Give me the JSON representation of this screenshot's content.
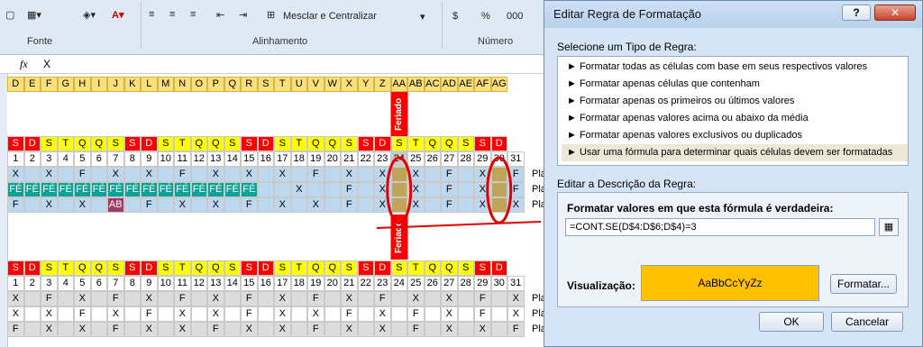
{
  "ribbon": {
    "groups": [
      "Fonte",
      "Alinhamento",
      "Número"
    ],
    "merge_label": "Mesclar e Centralizar",
    "currency_symbol": "$",
    "percent_symbol": "%",
    "thousands_symbol": "000"
  },
  "formula_bar": {
    "fx": "fx",
    "value": "X"
  },
  "sheet": {
    "columns": [
      "D",
      "E",
      "F",
      "G",
      "H",
      "I",
      "J",
      "K",
      "L",
      "M",
      "N",
      "O",
      "P",
      "Q",
      "R",
      "S",
      "T",
      "U",
      "V",
      "W",
      "X",
      "Y",
      "Z",
      "AA",
      "AB",
      "AC",
      "AD",
      "AE",
      "AF",
      "AG"
    ],
    "holiday_label": "Feriado",
    "weekdays": [
      "S",
      "D",
      "S",
      "T",
      "Q",
      "Q",
      "S",
      "S",
      "D",
      "S",
      "T",
      "Q",
      "Q",
      "S",
      "S",
      "D",
      "S",
      "T",
      "Q",
      "Q",
      "S",
      "S",
      "D",
      "S",
      "T",
      "Q",
      "Q",
      "S",
      "S",
      "D"
    ],
    "days": [
      "1",
      "2",
      "3",
      "4",
      "5",
      "6",
      "7",
      "8",
      "9",
      "10",
      "11",
      "12",
      "13",
      "14",
      "15",
      "16",
      "17",
      "18",
      "19",
      "20",
      "21",
      "22",
      "23",
      "24",
      "25",
      "26",
      "27",
      "28",
      "29",
      "30",
      "31"
    ],
    "row1": [
      "X",
      "",
      "X",
      "",
      "F",
      "",
      "X",
      "",
      "X",
      "",
      "F",
      "",
      "X",
      "",
      "X",
      "",
      "X",
      "",
      "F",
      "",
      "X",
      "",
      "X",
      "",
      "X",
      "",
      "F",
      "",
      "X",
      "",
      "F"
    ],
    "row2": [
      "FÉ",
      "FÉ",
      "FÉ",
      "FÉ",
      "FÉ",
      "FÉ",
      "FÉ",
      "FÉ",
      "FÉ",
      "FÉ",
      "FÉ",
      "FÉ",
      "FÉ",
      "FÉ",
      "FÉ",
      "",
      "",
      "X",
      "",
      "",
      "F",
      "",
      "X",
      "",
      "X",
      "",
      "F",
      "",
      "X",
      "",
      "F"
    ],
    "row3": [
      "F",
      "",
      "X",
      "",
      "X",
      "",
      "AB",
      "",
      "F",
      "",
      "X",
      "",
      "X",
      "",
      "F",
      "",
      "X",
      "",
      "X",
      "",
      "F",
      "",
      "X",
      "",
      "X",
      "",
      "F",
      "",
      "X",
      "",
      "X"
    ],
    "weekdays_b": [
      "S",
      "D",
      "S",
      "T",
      "Q",
      "Q",
      "S",
      "S",
      "D",
      "S",
      "T",
      "Q",
      "Q",
      "S",
      "S",
      "D",
      "S",
      "T",
      "Q",
      "Q",
      "S",
      "S",
      "D",
      "S",
      "T",
      "Q",
      "Q",
      "S",
      "S",
      "D"
    ],
    "days_b": [
      "1",
      "2",
      "3",
      "4",
      "5",
      "6",
      "7",
      "8",
      "9",
      "10",
      "11",
      "12",
      "13",
      "14",
      "15",
      "16",
      "17",
      "18",
      "19",
      "20",
      "21",
      "22",
      "23",
      "24",
      "25",
      "26",
      "27",
      "28",
      "29",
      "30",
      "31"
    ],
    "row4": [
      "X",
      "",
      "F",
      "",
      "X",
      "",
      "F",
      "",
      "X",
      "",
      "F",
      "",
      "X",
      "",
      "F",
      "",
      "X",
      "",
      "F",
      "",
      "X",
      "",
      "F",
      "",
      "X",
      "",
      "X",
      "",
      "F",
      "",
      "X"
    ],
    "row5": [
      "X",
      "",
      "X",
      "",
      "F",
      "",
      "X",
      "",
      "F",
      "",
      "X",
      "",
      "X",
      "",
      "F",
      "",
      "X",
      "",
      "X",
      "",
      "F",
      "",
      "X",
      "",
      "F",
      "",
      "X",
      "",
      "F",
      "",
      "X"
    ],
    "row6": [
      "F",
      "",
      "X",
      "",
      "X",
      "",
      "F",
      "",
      "X",
      "",
      "X",
      "",
      "F",
      "",
      "X",
      "",
      "X",
      "",
      "F",
      "",
      "X",
      "",
      "X",
      "",
      "F",
      "",
      "X",
      "",
      "X",
      "",
      "F"
    ],
    "row_suffix": "Pla"
  },
  "dialog": {
    "title": "Editar Regra de Formatação",
    "help_glyph": "?",
    "close_glyph": "✕",
    "section1_label": "Selecione um Tipo de Regra:",
    "rules": [
      "► Formatar todas as células com base em seus respectivos valores",
      "► Formatar apenas células que contenham",
      "► Formatar apenas os primeiros ou últimos valores",
      "► Formatar apenas valores acima ou abaixo da média",
      "► Formatar apenas valores exclusivos ou duplicados",
      "► Usar uma fórmula para determinar quais células devem ser formatadas"
    ],
    "selected_rule_index": 5,
    "section2_label": "Editar a Descrição da Regra:",
    "formula_label": "Formatar valores em que esta fórmula é verdadeira:",
    "formula_value": "=CONT.SE(D$4:D$6;D$4)=3",
    "preview_label": "Visualização:",
    "preview_sample": "AaBbCcYyZz",
    "preview_color": "#ffc000",
    "format_button": "Formatar...",
    "ok_button": "OK",
    "cancel_button": "Cancelar"
  }
}
